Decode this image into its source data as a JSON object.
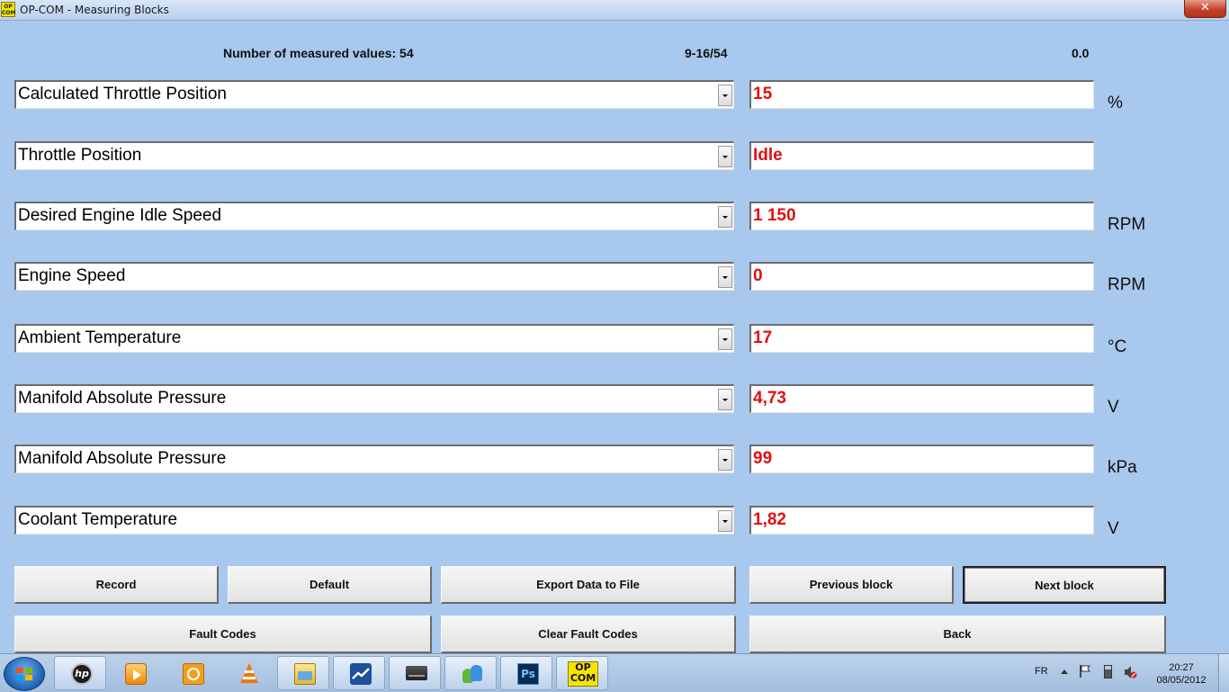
{
  "window": {
    "title": "OP-COM - Measuring Blocks",
    "close_label": "✕",
    "icon_text": [
      "OP",
      "COM"
    ]
  },
  "header": {
    "count_text": "Number of measured values: 54",
    "range_text": "9-16/54",
    "time_value": "0.0"
  },
  "rows": [
    {
      "label": "Calculated Throttle Position",
      "value": "15",
      "unit": "%"
    },
    {
      "label": "Throttle Position",
      "value": "Idle",
      "unit": ""
    },
    {
      "label": "Desired Engine Idle Speed",
      "value": "1 150",
      "unit": "RPM"
    },
    {
      "label": "Engine Speed",
      "value": "0",
      "unit": "RPM"
    },
    {
      "label": "Ambient Temperature",
      "value": "17",
      "unit": "°C"
    },
    {
      "label": "Manifold Absolute Pressure",
      "value": "4,73",
      "unit": "V"
    },
    {
      "label": "Manifold Absolute Pressure",
      "value": "99",
      "unit": "kPa"
    },
    {
      "label": "Coolant Temperature",
      "value": "1,82",
      "unit": "V"
    }
  ],
  "buttons": {
    "record": "Record",
    "default": "Default",
    "export": "Export Data to File",
    "previous": "Previous block",
    "next": "Next block",
    "fault_codes": "Fault Codes",
    "clear_fault_codes": "Clear Fault Codes",
    "back": "Back"
  },
  "taskbar": {
    "apps": [
      "hp-icon",
      "media-player-icon",
      "outlook-icon",
      "vlc-icon",
      "file-explorer-icon",
      "chart-app-icon",
      "dvd-drive-icon",
      "messenger-icon",
      "photoshop-icon",
      "opcom-icon"
    ],
    "photoshop_text": "Ps",
    "opcom_text": [
      "OP",
      "COM"
    ],
    "hp_text": "hp",
    "language": "FR",
    "clock_time": "20:27",
    "clock_date": "08/05/2012"
  },
  "colors": {
    "background": "#a8c8ee",
    "value_red": "#e01010",
    "opcom_yellow": "#f5e400"
  }
}
